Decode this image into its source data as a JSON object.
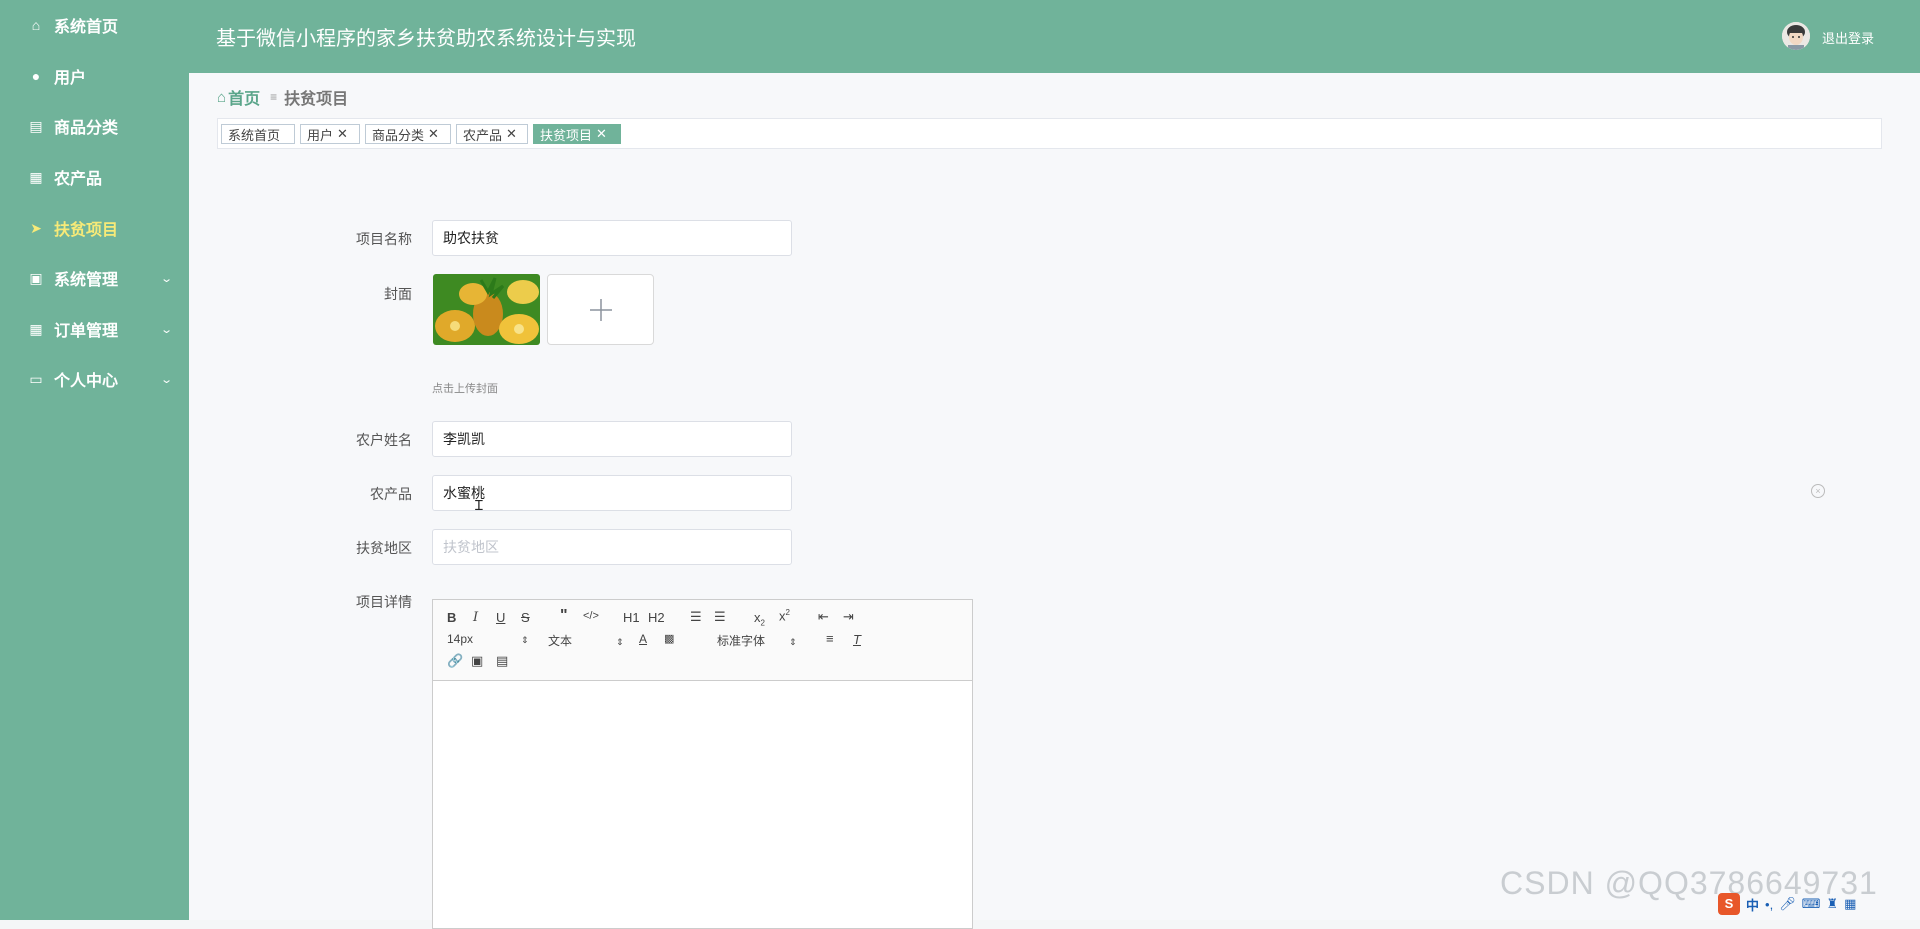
{
  "header": {
    "title": "基于微信小程序的家乡扶贫助农系统设计与实现",
    "logout": "退出登录"
  },
  "sidebar": {
    "items": [
      {
        "label": "系统首页",
        "icon": "home-icon"
      },
      {
        "label": "用户",
        "icon": "user-icon"
      },
      {
        "label": "商品分类",
        "icon": "document-icon"
      },
      {
        "label": "农产品",
        "icon": "grid-icon"
      },
      {
        "label": "扶贫项目",
        "icon": "send-icon",
        "active": true
      },
      {
        "label": "系统管理",
        "icon": "clipboard-icon",
        "expandable": true
      },
      {
        "label": "订单管理",
        "icon": "grid-icon",
        "expandable": true
      },
      {
        "label": "个人中心",
        "icon": "card-icon",
        "expandable": true
      }
    ]
  },
  "breadcrumb": {
    "home": "首页",
    "sep": "≡",
    "current": "扶贫项目"
  },
  "tags": [
    {
      "label": "系统首页",
      "closable": false
    },
    {
      "label": "用户",
      "closable": true
    },
    {
      "label": "商品分类",
      "closable": true
    },
    {
      "label": "农产品",
      "closable": true
    },
    {
      "label": "扶贫项目",
      "closable": true,
      "active": true
    }
  ],
  "tag_close": "✕",
  "form": {
    "project_name": {
      "label": "项目名称",
      "value": "助农扶贫"
    },
    "cover": {
      "label": "封面",
      "hint": "点击上传封面"
    },
    "farmer_name": {
      "label": "农户姓名",
      "value": "李凯凯"
    },
    "product": {
      "label": "农产品",
      "value": "水蜜桃"
    },
    "region": {
      "label": "扶贫地区",
      "placeholder": "扶贫地区"
    },
    "details": {
      "label": "项目详情"
    }
  },
  "editor": {
    "font_size": "14px",
    "text_type": "文本",
    "font_family": "标准字体",
    "h1": "H1",
    "h2": "H2"
  },
  "watermark": "CSDN @QQ3786649731",
  "ime": {
    "lang": "中"
  },
  "colors": {
    "sidebar": "#70b39a",
    "active_menu": "#f7ea78",
    "accent": "#5aa58a"
  }
}
